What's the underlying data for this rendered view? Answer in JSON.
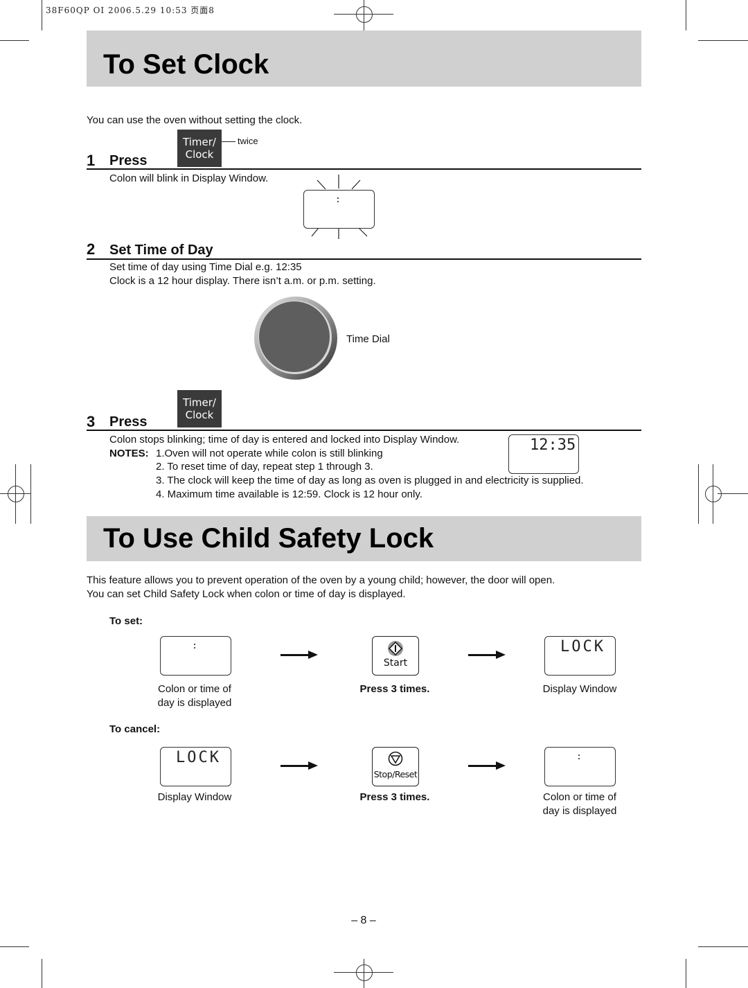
{
  "print_header": "38F60QP OI  2006.5.29 10:53  页面8",
  "clock_section": {
    "title": "To Set Clock",
    "intro": "You can use the oven without setting the clock.",
    "step1": {
      "number": "1",
      "label": "Press",
      "key_line1": "Timer/",
      "key_line2": "Clock",
      "key_note": "twice",
      "description": "Colon will blink in Display Window.",
      "display_value": ":"
    },
    "step2": {
      "number": "2",
      "label": "Set Time of Day",
      "line1": "Set time of day using Time Dial e.g. 12:35",
      "line2": "Clock is a 12 hour display. There isn’t a.m. or p.m. setting.",
      "dial_label": "Time Dial"
    },
    "step3": {
      "number": "3",
      "label": "Press",
      "key_line1": "Timer/",
      "key_line2": "Clock",
      "description": "Colon stops blinking; time of day is entered and locked into Display Window.",
      "display_value": "12:35"
    },
    "notes": {
      "label": "NOTES:",
      "items": [
        "1.Oven will not operate while colon is still blinking",
        "2. To reset time of day, repeat step 1 through 3.",
        "3. The clock will keep the time of day as long as oven is plugged in and electricity is supplied.",
        "4. Maximum time available is 12:59. Clock is 12 hour only."
      ]
    }
  },
  "lock_section": {
    "title": "To Use Child Safety Lock",
    "intro_line1": "This feature allows you to prevent operation of the oven by a young child; however, the door will open.",
    "intro_line2": "You can set Child Safety Lock when colon or time of day is displayed.",
    "to_set": {
      "heading": "To set:",
      "display_start": ":",
      "caption_start_line1": "Colon or time of",
      "caption_start_line2": "day is displayed",
      "key_label": "Start",
      "press_text": "Press 3 times.",
      "display_end": "LOCK",
      "caption_end": "Display Window"
    },
    "to_cancel": {
      "heading": "To cancel:",
      "display_start": "LOCK",
      "caption_start": "Display Window",
      "key_label": "Stop/Reset",
      "press_text": "Press 3 times.",
      "display_end": ":",
      "caption_end_line1": "Colon or time of",
      "caption_end_line2": "day is displayed"
    }
  },
  "page_number": "– 8 –"
}
